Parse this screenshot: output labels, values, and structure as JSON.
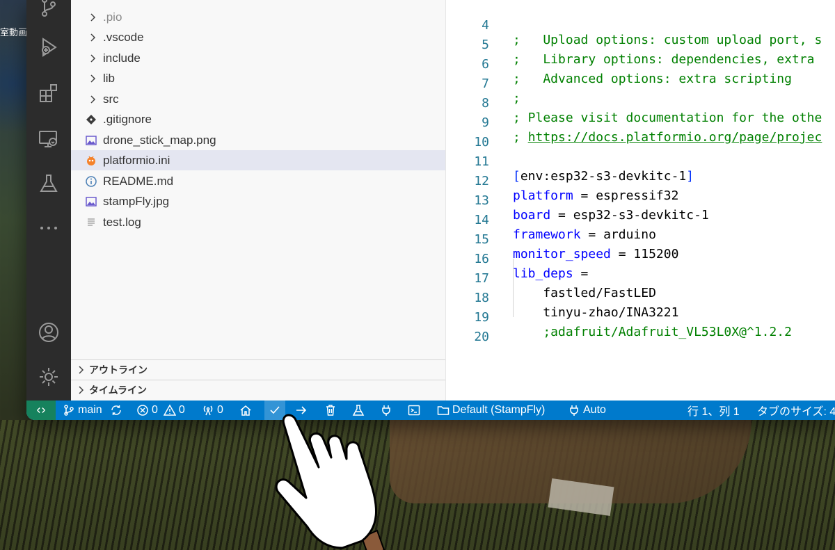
{
  "desktop": {
    "left_text": "室動画"
  },
  "explorer": {
    "items": [
      {
        "type": "folder",
        "label": ".pio",
        "dim": true
      },
      {
        "type": "folder",
        "label": ".vscode"
      },
      {
        "type": "folder",
        "label": "include"
      },
      {
        "type": "folder",
        "label": "lib"
      },
      {
        "type": "folder",
        "label": "src"
      },
      {
        "type": "file",
        "icon": "git-icon",
        "label": ".gitignore"
      },
      {
        "type": "file",
        "icon": "image-icon",
        "label": "drone_stick_map.png"
      },
      {
        "type": "file",
        "icon": "platformio-icon",
        "label": "platformio.ini",
        "selected": true
      },
      {
        "type": "file",
        "icon": "info-icon",
        "label": "README.md"
      },
      {
        "type": "file",
        "icon": "image-icon",
        "label": "stampFly.jpg"
      },
      {
        "type": "file",
        "icon": "text-lines-icon",
        "label": "test.log"
      }
    ],
    "outline_label": "アウトライン",
    "timeline_label": "タイムライン"
  },
  "editor": {
    "lines": [
      {
        "n": "4",
        "text": ";   Upload options: custom upload port, s"
      },
      {
        "n": "5",
        "text": ";   Library options: dependencies, extra"
      },
      {
        "n": "6",
        "text": ";   Advanced options: extra scripting"
      },
      {
        "n": "7",
        "text": ";"
      },
      {
        "n": "8",
        "text": "; Please visit documentation for the othe"
      },
      {
        "n": "9",
        "prefix": "; ",
        "link": "https://docs.platformio.org/page/projec"
      },
      {
        "n": "10",
        "text": ""
      },
      {
        "n": "11",
        "section": "env:esp32-s3-devkitc-1"
      },
      {
        "n": "12",
        "key": "platform",
        "value": "espressif32"
      },
      {
        "n": "13",
        "key": "board",
        "value": "esp32-s3-devkitc-1"
      },
      {
        "n": "14",
        "key": "framework",
        "value": "arduino"
      },
      {
        "n": "15",
        "key": "monitor_speed",
        "value": "115200"
      },
      {
        "n": "16",
        "key": "lib_deps",
        "value": ""
      },
      {
        "n": "17",
        "plain": "    fastled/FastLED"
      },
      {
        "n": "18",
        "plain": "    tinyu-zhao/INA3221"
      },
      {
        "n": "19",
        "comment_indented": "    ;adafruit/Adafruit_VL53L0X@^1.2.2"
      },
      {
        "n": "20",
        "text": ""
      }
    ]
  },
  "status_bar": {
    "branch": "main",
    "errors": "0",
    "warnings": "0",
    "ports": "0",
    "env": "Default (StampFly)",
    "port_mode": "Auto",
    "cursor_pos": "行 1、列 1",
    "tab_size": "タブのサイズ: 4"
  },
  "colors": {
    "status_bar": "#007acc",
    "remote": "#16825d",
    "activity_bar": "#2c2c2c",
    "line_number": "#237893",
    "comment": "#008000",
    "key": "#0000ff"
  }
}
